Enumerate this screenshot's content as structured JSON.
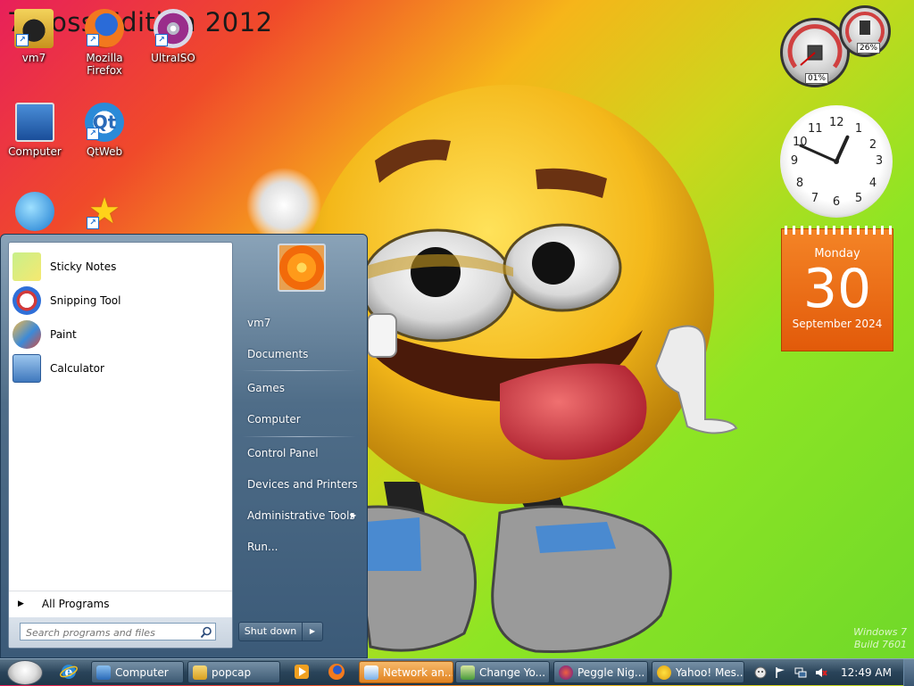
{
  "desktop": {
    "watermark_title": "7 Boss Edition 2012",
    "watermark_brand_line1": "Windows 7",
    "watermark_brand_line2": "Build 7601",
    "icons": [
      {
        "label": "vm7",
        "icon": "vm7-icon"
      },
      {
        "label": "Mozilla Firefox",
        "icon": "firefox-icon"
      },
      {
        "label": "UltraISO",
        "icon": "ultraiso-icon"
      },
      {
        "label": "Computer",
        "icon": "computer-icon"
      },
      {
        "label": "QtWeb",
        "icon": "qtweb-icon"
      }
    ]
  },
  "gadgets": {
    "cpu_meter": {
      "cpu_percent": "01%",
      "memory_percent": "26%"
    },
    "clock": {
      "numbers": [
        "12",
        "1",
        "2",
        "3",
        "4",
        "5",
        "6",
        "7",
        "8",
        "9",
        "10",
        "11"
      ],
      "time": "12:49"
    },
    "calendar": {
      "weekday": "Monday",
      "day": "30",
      "month_year": "September 2024"
    }
  },
  "start_menu": {
    "programs": [
      {
        "label": "Sticky Notes",
        "icon": "sticky-notes-icon"
      },
      {
        "label": "Snipping Tool",
        "icon": "snipping-tool-icon"
      },
      {
        "label": "Paint",
        "icon": "paint-icon"
      },
      {
        "label": "Calculator",
        "icon": "calculator-icon"
      }
    ],
    "all_programs": "All Programs",
    "search_placeholder": "Search programs and files",
    "right_links": [
      "vm7",
      "Documents",
      "Games",
      "Computer",
      "Control Panel",
      "Devices and Printers",
      "Administrative Tools",
      "Run..."
    ],
    "shut_down": "Shut down"
  },
  "taskbar": {
    "buttons": [
      {
        "label": "Computer",
        "active": false
      },
      {
        "label": "popcap",
        "active": false
      },
      {
        "label": "Network an...",
        "active": true
      },
      {
        "label": "Change Yo...",
        "active": false
      },
      {
        "label": "Peggle Nig...",
        "active": false
      },
      {
        "label": "Yahoo! Mes...",
        "active": false
      }
    ],
    "clock": "12:49 AM"
  },
  "colors": {
    "accent_orange": "#e8801e",
    "calendar_orange": "#f07820",
    "start_menu_blue": "#4f6d88"
  }
}
